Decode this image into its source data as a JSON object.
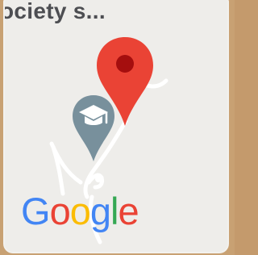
{
  "map": {
    "place_label": "ociety s...",
    "logo": {
      "text": "Google",
      "letters": [
        {
          "char": "G",
          "color": "#4285F4"
        },
        {
          "char": "o",
          "color": "#EA4335"
        },
        {
          "char": "o",
          "color": "#FBBC05"
        },
        {
          "char": "g",
          "color": "#4285F4"
        },
        {
          "char": "l",
          "color": "#34A853"
        },
        {
          "char": "e",
          "color": "#EA4335"
        }
      ]
    },
    "markers": [
      {
        "name": "location-pin",
        "icon": "red-map-pin-icon",
        "color": "#EA4335"
      },
      {
        "name": "school-pin",
        "icon": "graduation-cap-icon",
        "color": "#78909C"
      }
    ]
  }
}
